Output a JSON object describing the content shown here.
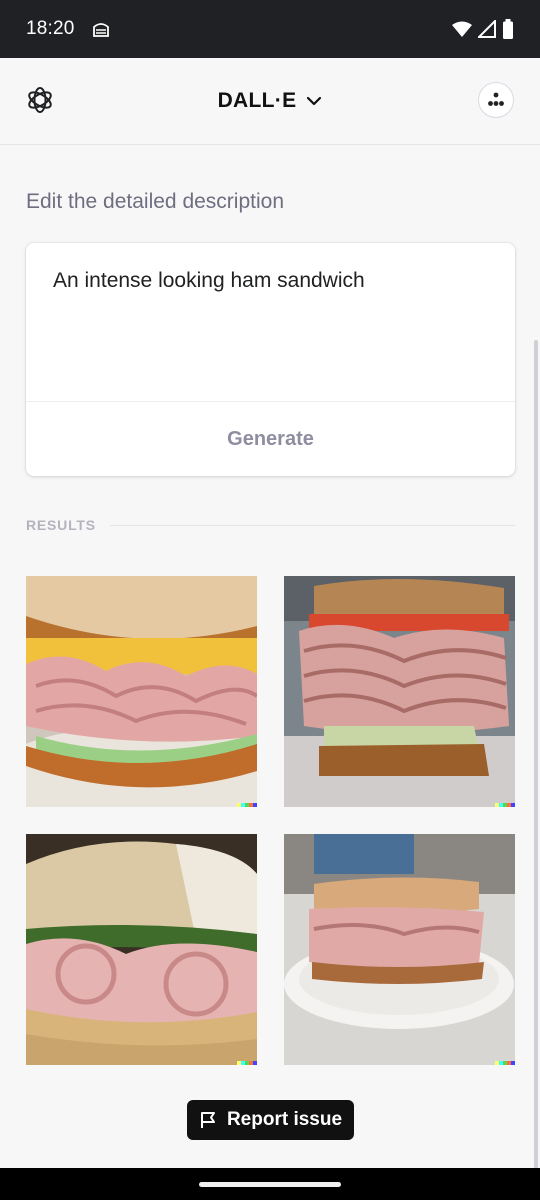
{
  "status_bar": {
    "time": "18:20",
    "left_icon": "vpn-lock-icon",
    "right_icons": [
      "wifi-icon",
      "signal-icon",
      "battery-icon"
    ]
  },
  "header": {
    "title": "DALL·E",
    "logo_icon": "openai-logo-icon",
    "dropdown_icon": "chevron-down-icon",
    "avatar_icon": "avatar-dots-icon"
  },
  "editor": {
    "section_label": "Edit the detailed description",
    "prompt": "An intense looking ham sandwich",
    "generate_label": "Generate"
  },
  "results": {
    "label": "RESULTS",
    "images": [
      {
        "alt": "ham sandwich result 1"
      },
      {
        "alt": "ham sandwich result 2"
      },
      {
        "alt": "ham sandwich result 3"
      },
      {
        "alt": "ham sandwich result 4"
      }
    ],
    "watermark_colors": [
      "#ffff66",
      "#42ffff",
      "#51da4c",
      "#ff6e3c",
      "#3c46ff"
    ]
  },
  "report": {
    "label": "Report issue",
    "icon": "flag-icon"
  },
  "colors": {
    "background": "#f7f7f8",
    "status_bar": "#202124",
    "report_button": "#111111"
  }
}
